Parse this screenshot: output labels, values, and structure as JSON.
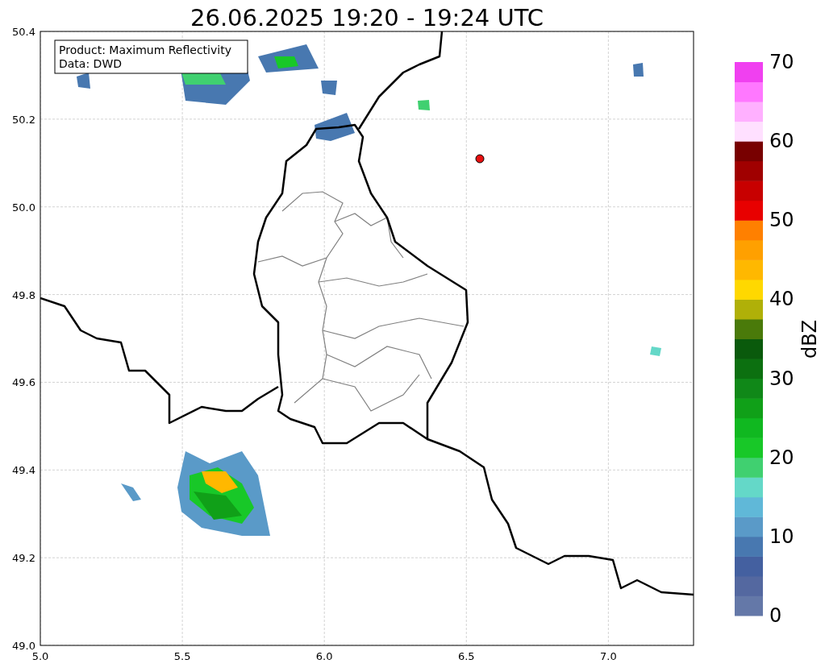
{
  "title": "26.06.2025 19:20 - 19:24 UTC",
  "info_box": [
    "Product: Maximum Reflectivity",
    "Data: DWD"
  ],
  "x_ticks": [
    "5.0",
    "5.5",
    "6.0",
    "6.5",
    "7.0"
  ],
  "y_ticks": [
    "50.4",
    "50.2",
    "50.0",
    "49.8",
    "49.6",
    "49.4",
    "49.2",
    "49.0"
  ],
  "colorbar": {
    "label": "dBZ",
    "ticks": [
      "70",
      "60",
      "50",
      "40",
      "30",
      "20",
      "10",
      "0"
    ],
    "bands": [
      {
        "color": "#6478a8"
      },
      {
        "color": "#5468a0"
      },
      {
        "color": "#4460a0"
      },
      {
        "color": "#4878b0"
      },
      {
        "color": "#5a9ac8"
      },
      {
        "color": "#60b8d8"
      },
      {
        "color": "#64d8c8"
      },
      {
        "color": "#40d070"
      },
      {
        "color": "#18c828"
      },
      {
        "color": "#10b820"
      },
      {
        "color": "#10a018"
      },
      {
        "color": "#108818"
      },
      {
        "color": "#0c7010"
      },
      {
        "color": "#0a5a0c"
      },
      {
        "color": "#4a7a0a"
      },
      {
        "color": "#b0b008"
      },
      {
        "color": "#ffd800"
      },
      {
        "color": "#ffb800"
      },
      {
        "color": "#ffa000"
      },
      {
        "color": "#ff8000"
      },
      {
        "color": "#e80000"
      },
      {
        "color": "#c80000"
      },
      {
        "color": "#a00000"
      },
      {
        "color": "#780000"
      },
      {
        "color": "#ffe0ff"
      },
      {
        "color": "#ffb0ff"
      },
      {
        "color": "#ff78ff"
      },
      {
        "color": "#f040f0"
      }
    ]
  }
}
